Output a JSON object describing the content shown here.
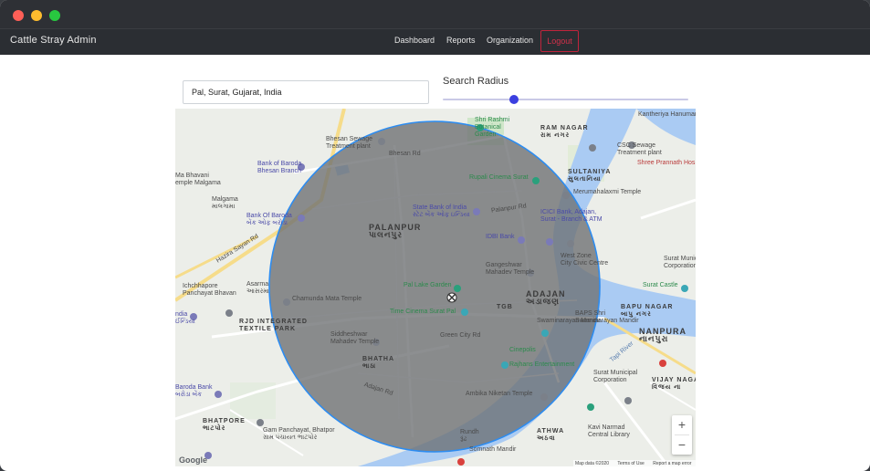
{
  "window": {
    "controls": [
      "close-dot",
      "minimize-dot",
      "zoom-dot"
    ]
  },
  "navbar": {
    "brand": "Cattle Stray Admin",
    "links": [
      "Dashboard",
      "Reports",
      "Organization"
    ],
    "logout_label": "Logout"
  },
  "search": {
    "value": "Pal, Surat, Gujarat, India"
  },
  "radius": {
    "label": "Search Radius",
    "slider_fraction": 0.29
  },
  "colors": {
    "accent": "#3b3fe0",
    "circle_stroke": "#2d8cf0",
    "circle_fill": "#6d6f72",
    "logout": "#d3304a",
    "river": "#aacbf3"
  },
  "map": {
    "labels": {
      "bhesan": "Bhesan Road",
      "sewage_left": "Bhesan Sewage\nTreatment plant",
      "bob_bhesan": "Bank of Baroda\nBhesan Branch",
      "ma_bhavani": "Ma Bhavani\nemple Malgama",
      "malgama": "Malgama\nમાલગામા",
      "bob_left": "Bank Of Baroda\nબેંક ઓફ બરોડા",
      "hazira": "Hazira Sayan Rd",
      "ichchhapore": "Ichchhapore\nPanchayat Bhavan",
      "asarma": "Asarma\nઆસરમા",
      "chamunda": "Chamunda Mata Temple",
      "rjd": "RJD INTEGRATED\nTEXTILE PARK",
      "ndia": "ndia\nઈન્ડિયા",
      "siddheshwar": "Siddheshwar\nMahadev Temple",
      "bhatha": "BHATHA\nભાઠા",
      "bhatpore": "BHATPORE\nભાટપોર",
      "gam": "Gam Panchayat, Bhatpor\nગ્રામ પંચાયત ભાટપોર",
      "baroda_bank": "Baroda Bank\nબરોડા બેંક",
      "palanpur": "PALANPUR\nપાલનપુર",
      "sbi": "State Bank of India\nસ્ટેટ બેંક ઓફ ઇન્ડિયા",
      "palanpur_rd": "Palanpur Rd",
      "pal_lake": "Pal Lake Garden",
      "time_cinema": "Time Cinema Surat Pal",
      "green_city": "Green City Rd",
      "adajan": "ADAJAN\nઅડાજણ",
      "tgb": "TGB",
      "gangeshwar": "Gangeshwar\nMahadev Temple",
      "idbi": "IDBI Bank",
      "icici": "ICICI Bank, Adajan,\nSurat - Branch & ATM",
      "rupali": "Rupali Cinema Surat",
      "shri_rashmi": "Shri Rashmi\nBotanical\nGarden",
      "ram_nagar": "RAM NAGAR\nરામ નગર",
      "sultaniya": "SULTANIYA\nસુલતાનિયા",
      "meruma": "Merumahalaxmi Temple",
      "west_zone": "West Zone\nCity Civic Centre",
      "swaminarayan": "Swaminarayan Mandir",
      "baps": "BAPS Shri\nSwaminarayan Mandir",
      "cinepolis": "Cinepolis",
      "rajhans": "Rajhans Entertainment",
      "ambika": "Ambika Niketan Temple",
      "rundh": "Rundh\nરૂંઢ",
      "somnath": "Somnath Mandir",
      "athwa": "ATHWA\nઅઠવા",
      "kavi": "Kavi Narmad\nCentral Library",
      "bapu": "BAPU NAGAR\nબાપુ નગર",
      "nanpura": "NANPURA\nનાનપુરા",
      "surat_castle": "Surat Castle",
      "surat_muni": "Surat Municipal\nCorporation",
      "vijay": "VIJAY NAGA\nવિજય ના",
      "csc": "CSC Sewage\nTreatment plant",
      "shree": "Shree Prannath Hos",
      "kantheriya": "Kantheriya Hanuman",
      "tapi_river": "Tapi River",
      "adajan_rd": "Adajan Rd",
      "surat_muni_right": "Surat Municipal\nCorporation",
      "rn_road": "Bhesan Rd"
    },
    "zoom_in": "+",
    "zoom_out": "−",
    "google": "Google",
    "footer": {
      "data": "Map data ©2020",
      "terms": "Terms of Use",
      "report": "Report a map error"
    }
  }
}
